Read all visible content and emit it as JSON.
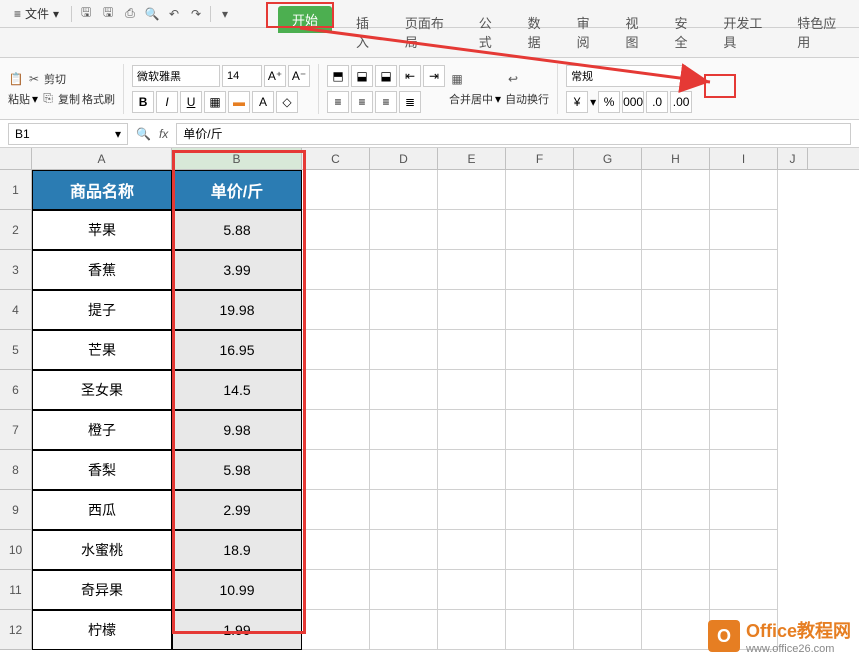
{
  "titlebar": {
    "file_label": "文件"
  },
  "tabs": {
    "start": "开始",
    "items": [
      "插入",
      "页面布局",
      "公式",
      "数据",
      "审阅",
      "视图",
      "安全",
      "开发工具",
      "特色应用"
    ]
  },
  "ribbon": {
    "cut": "剪切",
    "paste": "粘贴",
    "copy": "复制",
    "format_painter": "格式刷",
    "font_name": "微软雅黑",
    "font_size": "14",
    "merge_center": "合并居中",
    "auto_wrap": "自动换行",
    "number_format": "常规",
    "currency_symbol": "¥",
    "percent": "%"
  },
  "namebox": {
    "cell": "B1",
    "fx": "fx",
    "formula": "单价/斤"
  },
  "columns": [
    "A",
    "B",
    "C",
    "D",
    "E",
    "F",
    "G",
    "H",
    "I",
    "J"
  ],
  "table": {
    "headers": {
      "a": "商品名称",
      "b": "单价/斤"
    },
    "rows": [
      {
        "name": "苹果",
        "price": "5.88"
      },
      {
        "name": "香蕉",
        "price": "3.99"
      },
      {
        "name": "提子",
        "price": "19.98"
      },
      {
        "name": "芒果",
        "price": "16.95"
      },
      {
        "name": "圣女果",
        "price": "14.5"
      },
      {
        "name": "橙子",
        "price": "9.98"
      },
      {
        "name": "香梨",
        "price": "5.98"
      },
      {
        "name": "西瓜",
        "price": "2.99"
      },
      {
        "name": "水蜜桃",
        "price": "18.9"
      },
      {
        "name": "奇异果",
        "price": "10.99"
      },
      {
        "name": "柠檬",
        "price": "1.99"
      }
    ]
  },
  "watermark": {
    "title": "Office教程网",
    "url": "www.office26.com"
  }
}
